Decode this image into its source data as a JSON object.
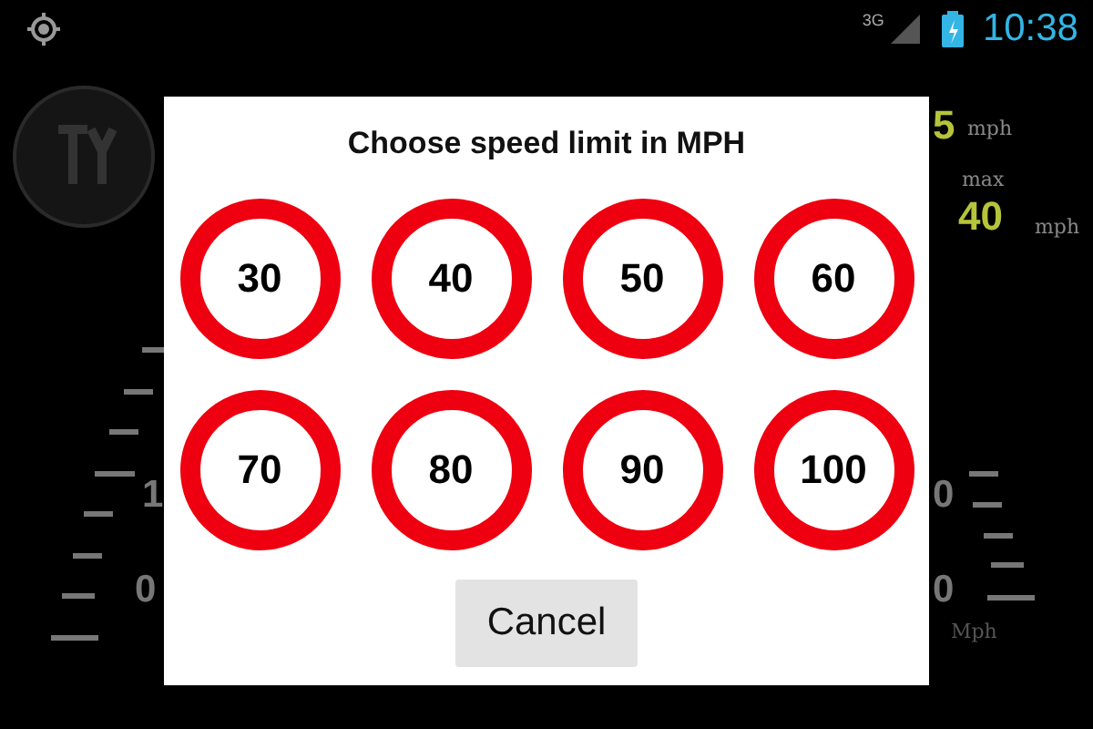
{
  "status_bar": {
    "network": "3G",
    "time": "10:38"
  },
  "dashboard": {
    "average_value": "5",
    "average_unit": "mph",
    "max_label": "max",
    "max_value": "40",
    "max_unit": "mph",
    "left_scale": [
      "1",
      "0"
    ],
    "right_scale": [
      "0",
      "0"
    ],
    "unit": "Mph"
  },
  "dialog": {
    "title": "Choose speed limit in MPH",
    "options": [
      "30",
      "40",
      "50",
      "60",
      "70",
      "80",
      "90",
      "100"
    ],
    "cancel": "Cancel"
  }
}
